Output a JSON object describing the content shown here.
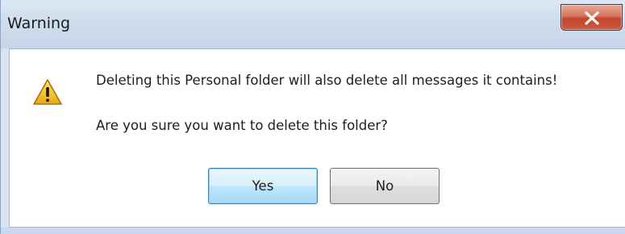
{
  "window": {
    "title": "Warning"
  },
  "dialog": {
    "message_primary": "Deleting this Personal folder will also delete all messages it contains!",
    "message_question": "Are you sure you want to delete this folder?",
    "icon": "warning-triangle-icon"
  },
  "buttons": {
    "yes_label": "Yes",
    "no_label": "No",
    "close_icon": "close-icon",
    "default": "Yes"
  },
  "colors": {
    "close_button": "#c95a3f",
    "warning_icon": "#f2c12e",
    "default_button_border": "#3c7fb1"
  }
}
